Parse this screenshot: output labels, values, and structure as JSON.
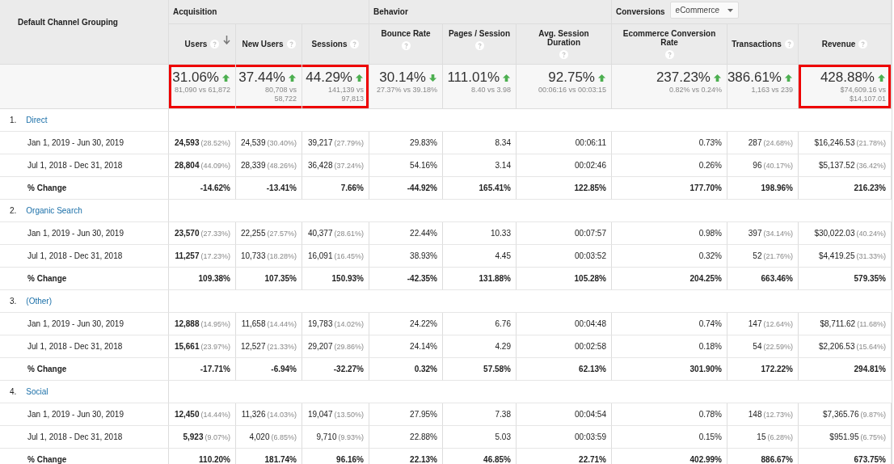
{
  "header": {
    "dimension": "Default Channel Grouping",
    "groups": [
      {
        "label": "Acquisition"
      },
      {
        "label": "Behavior"
      },
      {
        "label": "Conversions",
        "dropdown": "eCommerce"
      }
    ],
    "columns": [
      {
        "label": "Users",
        "sorted": true
      },
      {
        "label": "New Users",
        "sorted": false
      },
      {
        "label": "Sessions",
        "sorted": false
      },
      {
        "label": "Bounce Rate",
        "sorted": false
      },
      {
        "label": "Pages / Session",
        "sorted": false
      },
      {
        "label": "Avg. Session Duration",
        "sorted": false
      },
      {
        "label": "Ecommerce Conversion Rate",
        "sorted": false
      },
      {
        "label": "Transactions",
        "sorted": false
      },
      {
        "label": "Revenue",
        "sorted": false
      }
    ]
  },
  "summary": [
    {
      "value": "31.06%",
      "rising": true,
      "detail": "81,090 vs 61,872",
      "highlighted": true
    },
    {
      "value": "37.44%",
      "rising": true,
      "detail": "80,708 vs 58,722",
      "highlighted": true
    },
    {
      "value": "44.29%",
      "rising": true,
      "detail": "141,139 vs 97,813",
      "highlighted": true
    },
    {
      "value": "30.14%",
      "rising": false,
      "detail": "27.37% vs 39.18%",
      "highlighted": false
    },
    {
      "value": "111.01%",
      "rising": true,
      "detail": "8.40 vs 3.98",
      "highlighted": false
    },
    {
      "value": "92.75%",
      "rising": true,
      "detail": "00:06:16 vs 00:03:15",
      "highlighted": false
    },
    {
      "value": "237.23%",
      "rising": true,
      "detail": "0.82% vs 0.24%",
      "highlighted": false
    },
    {
      "value": "386.61%",
      "rising": true,
      "detail": "1,163 vs 239",
      "highlighted": false
    },
    {
      "value": "428.88%",
      "rising": true,
      "detail": "$74,609.16 vs $14,107.01",
      "highlighted": true
    }
  ],
  "channels": [
    {
      "index": "1.",
      "name": "Direct",
      "rows": [
        {
          "kind": "period",
          "label": "Jan 1, 2019 - Jun 30, 2019",
          "cells": [
            {
              "value": "24,593",
              "share": "(28.52%)"
            },
            {
              "value": "24,539",
              "share": "(30.40%)"
            },
            {
              "value": "39,217",
              "share": "(27.79%)"
            },
            {
              "value": "29.83%"
            },
            {
              "value": "8.34"
            },
            {
              "value": "00:06:11"
            },
            {
              "value": "0.73%"
            },
            {
              "value": "287",
              "share": "(24.68%)"
            },
            {
              "value": "$16,246.53",
              "share": "(21.78%)"
            }
          ]
        },
        {
          "kind": "period",
          "label": "Jul 1, 2018 - Dec 31, 2018",
          "cells": [
            {
              "value": "28,804",
              "share": "(44.09%)"
            },
            {
              "value": "28,339",
              "share": "(48.26%)"
            },
            {
              "value": "36,428",
              "share": "(37.24%)"
            },
            {
              "value": "54.16%"
            },
            {
              "value": "3.14"
            },
            {
              "value": "00:02:46"
            },
            {
              "value": "0.26%"
            },
            {
              "value": "96",
              "share": "(40.17%)"
            },
            {
              "value": "$5,137.52",
              "share": "(36.42%)"
            }
          ]
        },
        {
          "kind": "change",
          "label": "% Change",
          "cells": [
            {
              "value": "-14.62%"
            },
            {
              "value": "-13.41%"
            },
            {
              "value": "7.66%"
            },
            {
              "value": "-44.92%"
            },
            {
              "value": "165.41%"
            },
            {
              "value": "122.85%"
            },
            {
              "value": "177.70%"
            },
            {
              "value": "198.96%"
            },
            {
              "value": "216.23%"
            }
          ]
        }
      ]
    },
    {
      "index": "2.",
      "name": "Organic Search",
      "rows": [
        {
          "kind": "period",
          "label": "Jan 1, 2019 - Jun 30, 2019",
          "cells": [
            {
              "value": "23,570",
              "share": "(27.33%)"
            },
            {
              "value": "22,255",
              "share": "(27.57%)"
            },
            {
              "value": "40,377",
              "share": "(28.61%)"
            },
            {
              "value": "22.44%"
            },
            {
              "value": "10.33"
            },
            {
              "value": "00:07:57"
            },
            {
              "value": "0.98%"
            },
            {
              "value": "397",
              "share": "(34.14%)"
            },
            {
              "value": "$30,022.03",
              "share": "(40.24%)"
            }
          ]
        },
        {
          "kind": "period",
          "label": "Jul 1, 2018 - Dec 31, 2018",
          "cells": [
            {
              "value": "11,257",
              "share": "(17.23%)"
            },
            {
              "value": "10,733",
              "share": "(18.28%)"
            },
            {
              "value": "16,091",
              "share": "(16.45%)"
            },
            {
              "value": "38.93%"
            },
            {
              "value": "4.45"
            },
            {
              "value": "00:03:52"
            },
            {
              "value": "0.32%"
            },
            {
              "value": "52",
              "share": "(21.76%)"
            },
            {
              "value": "$4,419.25",
              "share": "(31.33%)"
            }
          ]
        },
        {
          "kind": "change",
          "label": "% Change",
          "cells": [
            {
              "value": "109.38%"
            },
            {
              "value": "107.35%"
            },
            {
              "value": "150.93%"
            },
            {
              "value": "-42.35%"
            },
            {
              "value": "131.88%"
            },
            {
              "value": "105.28%"
            },
            {
              "value": "204.25%"
            },
            {
              "value": "663.46%"
            },
            {
              "value": "579.35%"
            }
          ]
        }
      ]
    },
    {
      "index": "3.",
      "name": "(Other)",
      "rows": [
        {
          "kind": "period",
          "label": "Jan 1, 2019 - Jun 30, 2019",
          "cells": [
            {
              "value": "12,888",
              "share": "(14.95%)"
            },
            {
              "value": "11,658",
              "share": "(14.44%)"
            },
            {
              "value": "19,783",
              "share": "(14.02%)"
            },
            {
              "value": "24.22%"
            },
            {
              "value": "6.76"
            },
            {
              "value": "00:04:48"
            },
            {
              "value": "0.74%"
            },
            {
              "value": "147",
              "share": "(12.64%)"
            },
            {
              "value": "$8,711.62",
              "share": "(11.68%)"
            }
          ]
        },
        {
          "kind": "period",
          "label": "Jul 1, 2018 - Dec 31, 2018",
          "cells": [
            {
              "value": "15,661",
              "share": "(23.97%)"
            },
            {
              "value": "12,527",
              "share": "(21.33%)"
            },
            {
              "value": "29,207",
              "share": "(29.86%)"
            },
            {
              "value": "24.14%"
            },
            {
              "value": "4.29"
            },
            {
              "value": "00:02:58"
            },
            {
              "value": "0.18%"
            },
            {
              "value": "54",
              "share": "(22.59%)"
            },
            {
              "value": "$2,206.53",
              "share": "(15.64%)"
            }
          ]
        },
        {
          "kind": "change",
          "label": "% Change",
          "cells": [
            {
              "value": "-17.71%"
            },
            {
              "value": "-6.94%"
            },
            {
              "value": "-32.27%"
            },
            {
              "value": "0.32%"
            },
            {
              "value": "57.58%"
            },
            {
              "value": "62.13%"
            },
            {
              "value": "301.90%"
            },
            {
              "value": "172.22%"
            },
            {
              "value": "294.81%"
            }
          ]
        }
      ]
    },
    {
      "index": "4.",
      "name": "Social",
      "rows": [
        {
          "kind": "period",
          "label": "Jan 1, 2019 - Jun 30, 2019",
          "cells": [
            {
              "value": "12,450",
              "share": "(14.44%)"
            },
            {
              "value": "11,326",
              "share": "(14.03%)"
            },
            {
              "value": "19,047",
              "share": "(13.50%)"
            },
            {
              "value": "27.95%"
            },
            {
              "value": "7.38"
            },
            {
              "value": "00:04:54"
            },
            {
              "value": "0.78%"
            },
            {
              "value": "148",
              "share": "(12.73%)"
            },
            {
              "value": "$7,365.76",
              "share": "(9.87%)"
            }
          ]
        },
        {
          "kind": "period",
          "label": "Jul 1, 2018 - Dec 31, 2018",
          "cells": [
            {
              "value": "5,923",
              "share": "(9.07%)"
            },
            {
              "value": "4,020",
              "share": "(6.85%)"
            },
            {
              "value": "9,710",
              "share": "(9.93%)"
            },
            {
              "value": "22.88%"
            },
            {
              "value": "5.03"
            },
            {
              "value": "00:03:59"
            },
            {
              "value": "0.15%"
            },
            {
              "value": "15",
              "share": "(6.28%)"
            },
            {
              "value": "$951.95",
              "share": "(6.75%)"
            }
          ]
        },
        {
          "kind": "change",
          "label": "% Change",
          "cells": [
            {
              "value": "110.20%"
            },
            {
              "value": "181.74%"
            },
            {
              "value": "96.16%"
            },
            {
              "value": "22.13%"
            },
            {
              "value": "46.85%"
            },
            {
              "value": "22.71%"
            },
            {
              "value": "402.99%"
            },
            {
              "value": "886.67%"
            },
            {
              "value": "673.75%"
            }
          ]
        }
      ]
    }
  ]
}
